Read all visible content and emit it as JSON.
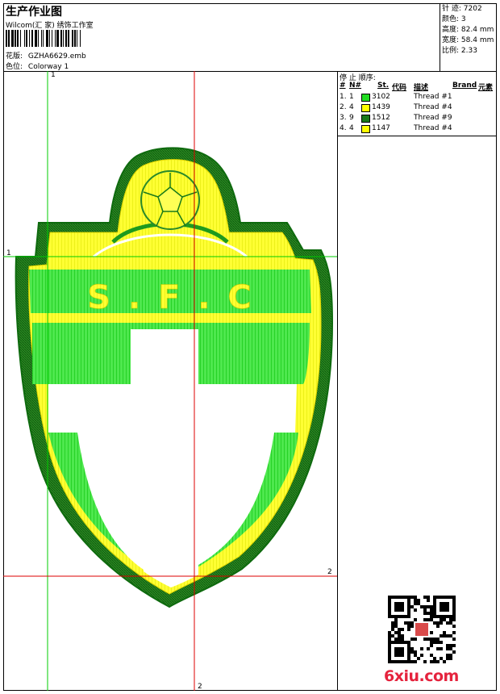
{
  "header": {
    "title": "生产作业图",
    "company": "Wilcom(汇 家) 绣饰工作室",
    "design_label": "花版:",
    "design_value": "GZHA6629.emb",
    "colorway_label": "色位:",
    "colorway_value": "Colorway 1"
  },
  "stats": {
    "stitches_label": "针 迹:",
    "stitches_value": "7202",
    "colors_label": "颜色:",
    "colors_value": "3",
    "height_label": "高度:",
    "height_value": "82.4 mm",
    "width_label": "宽度:",
    "width_value": "58.4 mm",
    "scale_label": "比例:",
    "scale_value": "2.33"
  },
  "stop_sequence": {
    "title": "停 止 顺序:",
    "columns": {
      "stop": "#",
      "needle": "N#",
      "st": "St.",
      "code": "代码",
      "desc": "描述",
      "brand": "Brand",
      "element": "元素"
    },
    "rows": [
      {
        "stop": "1.",
        "needle": "1",
        "color": "#22dd22",
        "code": "3102",
        "desc": "Thread #1"
      },
      {
        "stop": "2.",
        "needle": "4",
        "color": "#ffff00",
        "code": "1439",
        "desc": "Thread #4"
      },
      {
        "stop": "3.",
        "needle": "9",
        "color": "#1a7a1a",
        "code": "1512",
        "desc": "Thread #9"
      },
      {
        "stop": "4.",
        "needle": "4",
        "color": "#ffff00",
        "code": "1147",
        "desc": "Thread #4"
      }
    ]
  },
  "design": {
    "lettering": "S . F . C"
  },
  "axes": {
    "marker_1_top": "1",
    "marker_1_left": "1",
    "marker_2_right": "2",
    "marker_2_bottom": "2"
  },
  "watermark": "6xiu.com",
  "colors": {
    "light_green": "#22dd22",
    "yellow": "#ffff00",
    "dark_green": "#1a7a1a",
    "guide_green": "#00cc00",
    "guide_red": "#dd0000"
  }
}
